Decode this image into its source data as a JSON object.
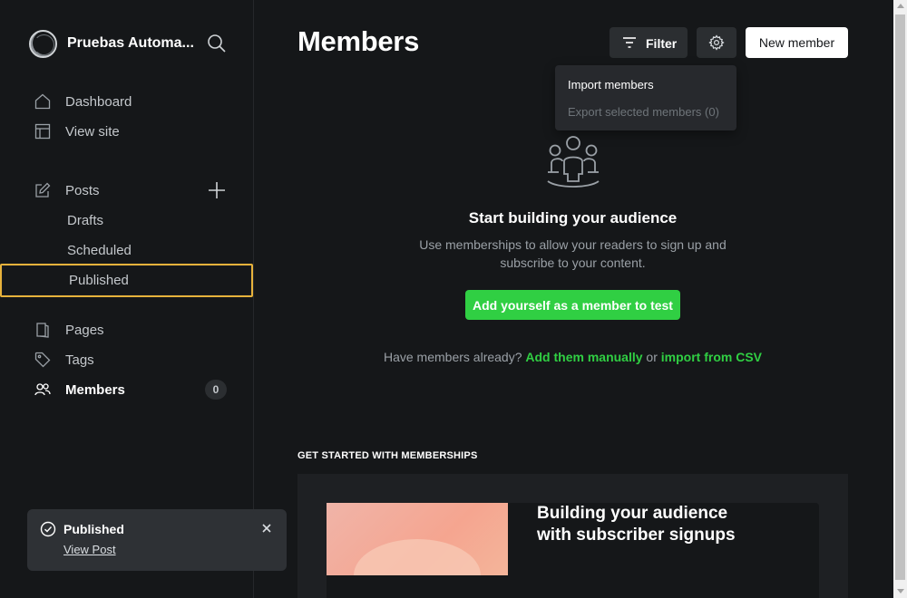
{
  "site": {
    "title": "Pruebas Automa..."
  },
  "sidebar": {
    "items": [
      {
        "label": "Dashboard",
        "icon": "home-icon"
      },
      {
        "label": "View site",
        "icon": "layout-icon"
      },
      {
        "label": "Posts",
        "icon": "edit-icon"
      },
      {
        "label": "Drafts"
      },
      {
        "label": "Scheduled"
      },
      {
        "label": "Published"
      },
      {
        "label": "Pages",
        "icon": "pages-icon"
      },
      {
        "label": "Tags",
        "icon": "tag-icon"
      },
      {
        "label": "Members",
        "icon": "members-icon",
        "count": "0"
      }
    ]
  },
  "header": {
    "title": "Members",
    "filter_label": "Filter",
    "new_member_label": "New member"
  },
  "dropdown": {
    "import_label": "Import members",
    "export_label": "Export selected members (0)"
  },
  "empty_state": {
    "title": "Start building your audience",
    "description": "Use memberships to allow your readers to sign up and subscribe to your content.",
    "cta_label": "Add yourself as a member to test",
    "have_members_prefix": "Have members already?",
    "add_manually_label": "Add them manually",
    "or_text": "or",
    "import_csv_label": "import from CSV"
  },
  "get_started": {
    "heading": "GET STARTED WITH MEMBERSHIPS",
    "card_title": "Building your audience with subscriber signups"
  },
  "toast": {
    "title": "Published",
    "link_label": "View Post"
  },
  "colors": {
    "accent_green": "#30cf43",
    "highlight_border": "#e7b23b",
    "background": "#151719"
  }
}
